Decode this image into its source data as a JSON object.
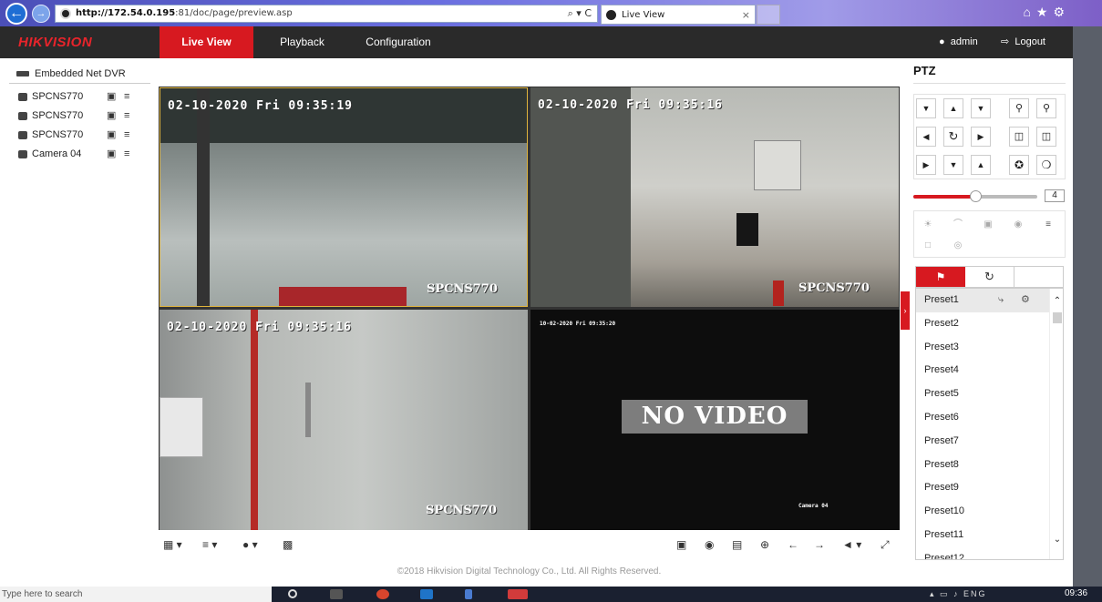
{
  "browser": {
    "url_host": "http://172.54.0.195",
    "url_path": ":81/doc/page/preview.asp",
    "address_controls": "⌕ ▾ C",
    "tab_title": "Live View",
    "tab_close": "×",
    "toolbar_icons": "⌂★⚙"
  },
  "nav": {
    "logo": "HIKVISION",
    "live_view": "Live View",
    "playback": "Playback",
    "configuration": "Configuration",
    "user": "admin",
    "logout": "Logout"
  },
  "tree": {
    "root": "Embedded Net DVR",
    "cameras": [
      "SPCNS770",
      "SPCNS770",
      "SPCNS770",
      "Camera 04"
    ]
  },
  "video": {
    "tiles": [
      {
        "timestamp": "02-10-2020 Fri 09:35:19",
        "channel": "SPCNS770"
      },
      {
        "timestamp": "02-10-2020 Fri 09:35:16",
        "channel": "SPCNS770"
      },
      {
        "timestamp": "02-10-2020 Fri 09:35:16",
        "channel": "SPCNS770"
      },
      {
        "timestamp": "10-02-2020 Fri 09:35:20",
        "channel": "Camera 04",
        "message": "NO VIDEO"
      }
    ]
  },
  "ptz": {
    "title": "PTZ",
    "speed": "4",
    "speed_level": 0.5,
    "presets": [
      "Preset1",
      "Preset2",
      "Preset3",
      "Preset4",
      "Preset5",
      "Preset6",
      "Preset7",
      "Preset8",
      "Preset9",
      "Preset10",
      "Preset11",
      "Preset12"
    ]
  },
  "footer": "©2018 Hikvision Digital Technology Co., Ltd. All Rights Reserved.",
  "taskbar": {
    "search_text": "Type here to search",
    "clock": "09:36",
    "tray": "▴ ▭ ♪ ENG"
  },
  "colors": {
    "accent": "#d71920",
    "nav_bg": "#2a2a2a",
    "selected_border": "#e0b43c"
  }
}
